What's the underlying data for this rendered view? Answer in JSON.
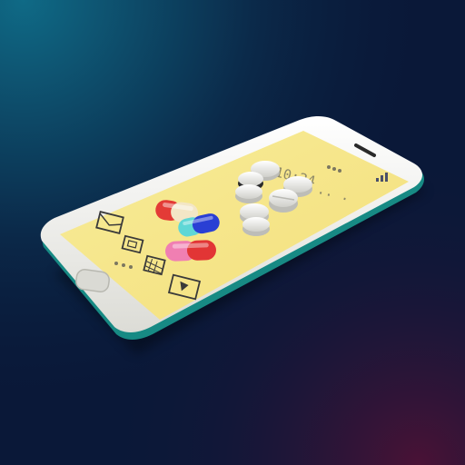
{
  "scene": {
    "description_free": true,
    "clock_time": "10:24",
    "colors": {
      "background_top_left": "#0d5a73",
      "background_center": "#0a1838",
      "background_bottom_right": "#3c1133",
      "phone_body": "#f2f2ee",
      "phone_edge": "#1a8a86",
      "screen": "#f6e68a",
      "pill_red": "#e53b3b",
      "pill_blue": "#2b3fd6",
      "pill_cyan": "#5fd6d8",
      "pill_pink": "#f07fb0",
      "pill_cream": "#f4e6c8",
      "tablet_white": "#f4f4f0"
    },
    "screen_icons": [
      "email-icon",
      "image-icon",
      "grid-icon",
      "download-icon",
      "signal-icon",
      "page-indicator-dots"
    ]
  }
}
